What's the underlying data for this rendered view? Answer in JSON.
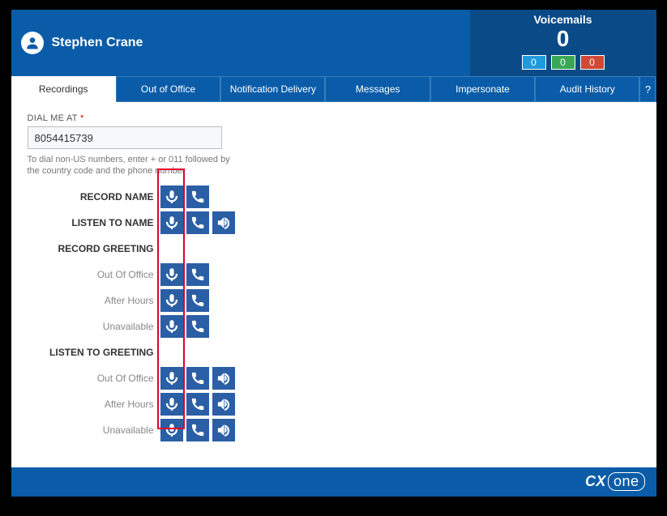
{
  "header": {
    "user_name": "Stephen Crane",
    "vm_title": "Voicemails",
    "vm_count": "0",
    "badge_blue": "0",
    "badge_green": "0",
    "badge_red": "0"
  },
  "tabs": {
    "recordings": "Recordings",
    "ooo": "Out of Office",
    "notif": "Notification Delivery",
    "messages": "Messages",
    "impersonate": "Impersonate",
    "audit": "Audit History"
  },
  "help_glyph": "?",
  "dial": {
    "label": "DIAL ME AT",
    "asterisk": "*",
    "value": "8054415739",
    "hint": "To dial non-US numbers, enter + or 011 followed by the country code and the phone number"
  },
  "sections": {
    "record_name": "RECORD NAME",
    "listen_name": "LISTEN TO NAME",
    "record_greeting": "RECORD GREETING",
    "listen_greeting": "LISTEN TO GREETING",
    "out_of_office": "Out Of Office",
    "after_hours": "After Hours",
    "unavailable": "Unavailable"
  },
  "footer": {
    "logo_cx": "CX",
    "logo_one": "one"
  }
}
